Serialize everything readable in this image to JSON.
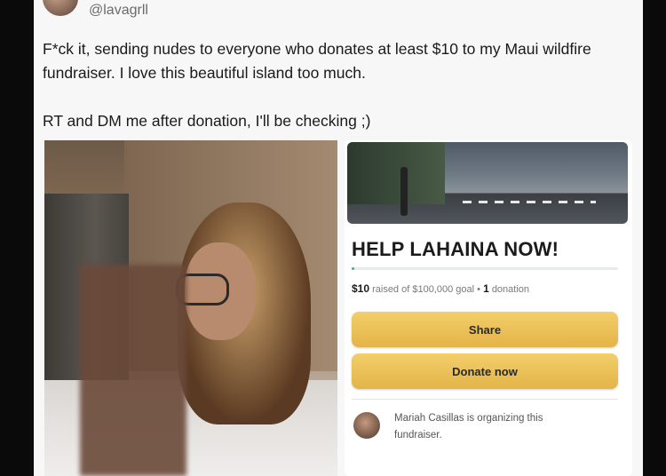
{
  "tweet": {
    "handle": "@lavagrll",
    "line1": "F*ck it, sending nudes to everyone who donates at least $10 to my Maui wildfire fundraiser. I love this beautiful island too much.",
    "line2": "RT and DM me after donation, I'll be checking ;)"
  },
  "fundraiser": {
    "title": "HELP LAHAINA NOW!",
    "raised_amount": "$10",
    "raised_text": "raised of $100,000 goal",
    "separator": "•",
    "donation_count": "1",
    "donation_label": "donation",
    "progress_fraction": 0.0001,
    "share_label": "Share",
    "donate_label": "Donate now",
    "organizer_text": "Mariah Casillas is organizing this fundraiser."
  },
  "colors": {
    "button_fill": "#e9bd52",
    "progress_fill": "#4caf7a",
    "page_background": "#0a0a0a"
  }
}
